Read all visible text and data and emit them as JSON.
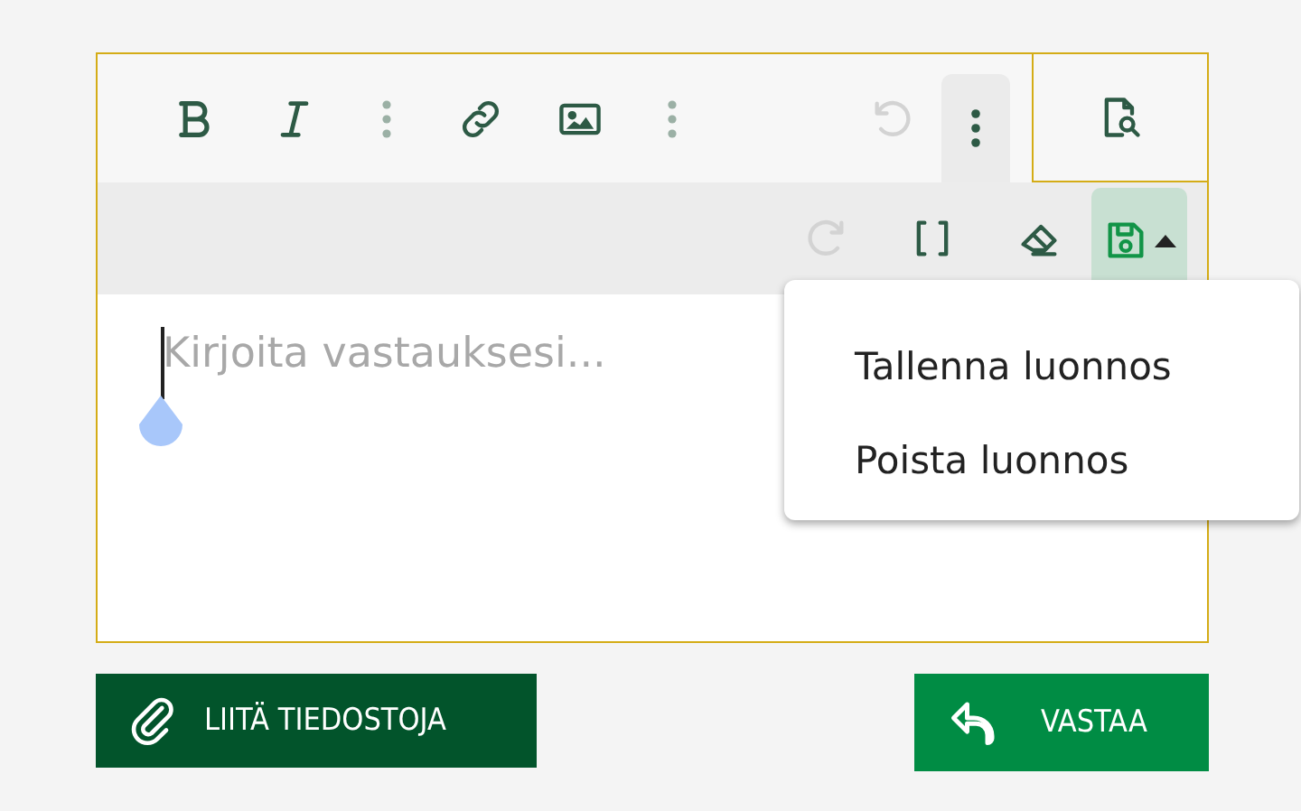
{
  "toolbar": {
    "row_1": [
      {
        "kind": "bold",
        "disabled": false
      },
      {
        "kind": "italic",
        "disabled": false
      },
      {
        "kind": "separator",
        "disabled": false
      },
      {
        "kind": "link",
        "disabled": false
      },
      {
        "kind": "image",
        "disabled": false
      },
      {
        "kind": "separator",
        "disabled": false
      },
      {
        "kind": "undo",
        "disabled": true
      },
      {
        "kind": "more",
        "disabled": false,
        "expanded": true
      }
    ],
    "preview": {
      "kind": "preview"
    },
    "row_2": [
      {
        "kind": "redo",
        "disabled": true
      },
      {
        "kind": "code",
        "disabled": false
      },
      {
        "kind": "eraser",
        "disabled": false
      },
      {
        "kind": "save",
        "disabled": false,
        "expanded": true
      }
    ]
  },
  "editor": {
    "placeholder": "Kirjoita vastauksesi..."
  },
  "save_menu": {
    "items": [
      "Tallenna luonnos",
      "Poista luonnos"
    ]
  },
  "buttons": [
    {
      "kind": "attach",
      "label": "LIITÄ TIEDOSTOJA"
    },
    {
      "kind": "reply",
      "label": "VASTAA"
    }
  ]
}
